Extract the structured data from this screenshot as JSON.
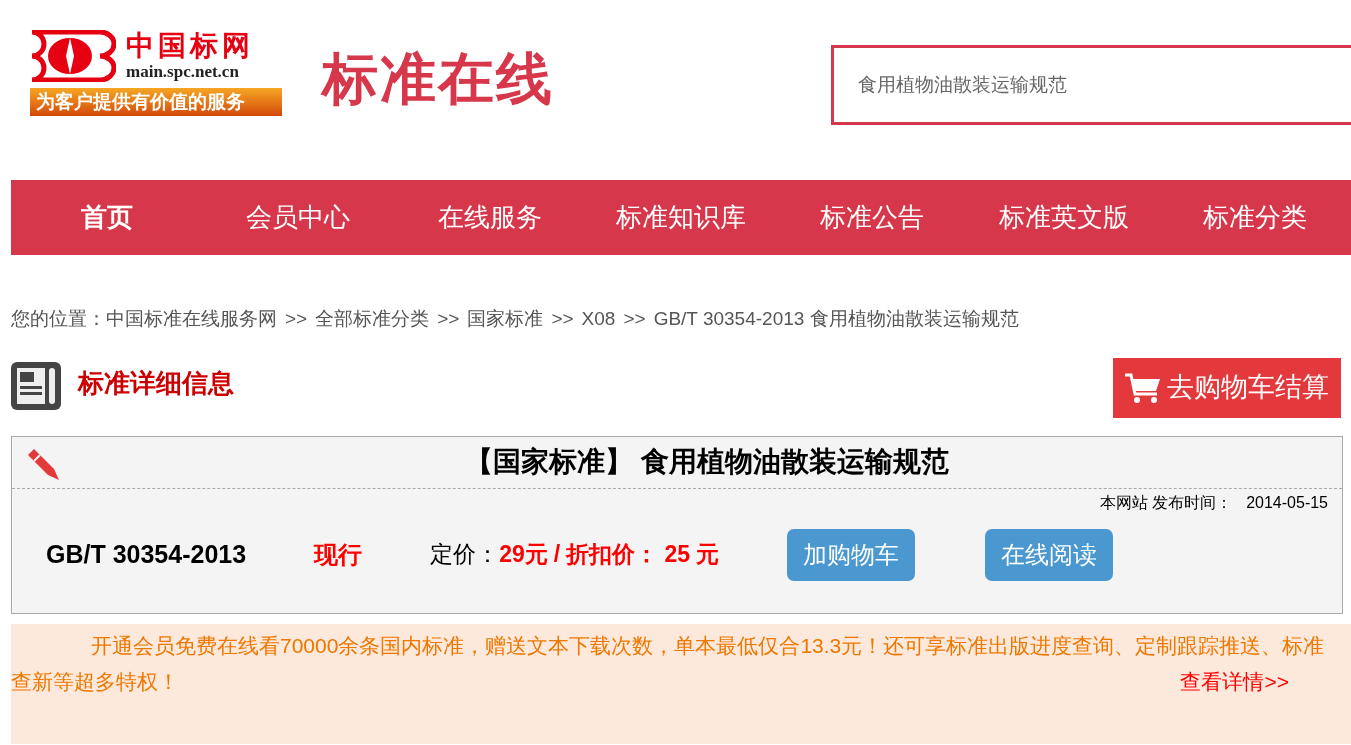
{
  "logo": {
    "name": "中国标网",
    "domain": "main.spc.net.cn",
    "slogan": "为客户提供有价值的服务"
  },
  "site_title": "标准在线",
  "search": {
    "value": "食用植物油散装运输规范"
  },
  "nav": [
    {
      "label": "首页",
      "selected": true
    },
    {
      "label": "会员中心",
      "selected": false
    },
    {
      "label": "在线服务",
      "selected": false
    },
    {
      "label": "标准知识库",
      "selected": false
    },
    {
      "label": "标准公告",
      "selected": false
    },
    {
      "label": "标准英文版",
      "selected": false
    },
    {
      "label": "标准分类",
      "selected": false
    }
  ],
  "breadcrumb": {
    "label": "您的位置：",
    "items": [
      "中国标准在线服务网",
      "全部标准分类",
      "国家标准",
      "X08",
      "GB/T 30354-2013 食用植物油散装运输规范"
    ],
    "separator": ">>"
  },
  "section_title": "标准详细信息",
  "checkout_button": "去购物车结算",
  "standard": {
    "title": "【国家标准】 食用植物油散装运输规范",
    "publish_label": "本网站 发布时间：",
    "publish_date": "2014-05-15",
    "code": "GB/T 30354-2013",
    "status": "现行",
    "price_label": "定价：",
    "list_price": "29元",
    "discount_label": "/ 折扣价：",
    "discount_price": "25 元",
    "buttons": [
      "加购物车",
      "在线阅读"
    ]
  },
  "promo": {
    "text": "开通会员免费在线看70000余条国内标准，赠送文本下载次数，单本最低仅合13.3元！还可享标准出版进度查询、定制跟踪推送、标准查新等超多特权！",
    "link": "查看详情>>"
  }
}
